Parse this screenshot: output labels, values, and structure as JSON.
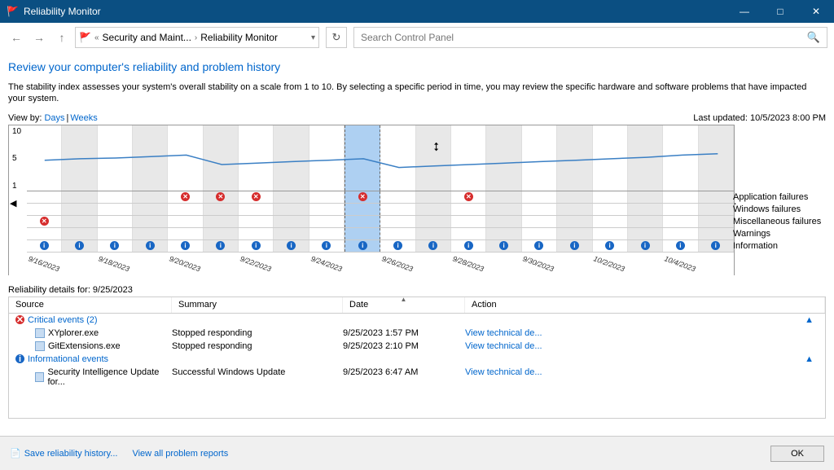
{
  "window": {
    "title": "Reliability Monitor"
  },
  "breadcrumb": {
    "segment1": "Security and Maint...",
    "segment2": "Reliability Monitor"
  },
  "search": {
    "placeholder": "Search Control Panel"
  },
  "page": {
    "title": "Review your computer's reliability and problem history",
    "description": "The stability index assesses your system's overall stability on a scale from 1 to 10. By selecting a specific period in time, you may review the specific hardware and software problems that have impacted your system.",
    "viewby_label": "View by:",
    "viewby_days": "Days",
    "viewby_weeks": "Weeks",
    "last_updated_label": "Last updated:",
    "last_updated_value": "10/5/2023 8:00 PM"
  },
  "row_labels": {
    "r1": "Application failures",
    "r2": "Windows failures",
    "r3": "Miscellaneous failures",
    "r4": "Warnings",
    "r5": "Information"
  },
  "yaxis": {
    "t10": "10",
    "t5": "5",
    "t1": "1"
  },
  "details": {
    "caption": "Reliability details for: 9/25/2023",
    "hdr_source": "Source",
    "hdr_summary": "Summary",
    "hdr_date": "Date",
    "hdr_action": "Action",
    "group_critical": "Critical events (2)",
    "group_info": "Informational events",
    "rows": {
      "r1_src": "XYplorer.exe",
      "r1_sum": "Stopped responding",
      "r1_dat": "9/25/2023 1:57 PM",
      "r1_act": "View technical de...",
      "r2_src": "GitExtensions.exe",
      "r2_sum": "Stopped responding",
      "r2_dat": "9/25/2023 2:10 PM",
      "r2_act": "View technical de...",
      "r3_src": "Security Intelligence Update for...",
      "r3_sum": "Successful Windows Update",
      "r3_dat": "9/25/2023 6:47 AM",
      "r3_act": "View technical de..."
    }
  },
  "footer": {
    "save": "Save reliability history...",
    "viewall": "View all problem reports",
    "ok": "OK"
  },
  "chart_data": {
    "type": "line",
    "title": "Stability index",
    "ylabel": "",
    "xlabel": "",
    "ylim": [
      1,
      10
    ],
    "x_dates": [
      "9/16/2023",
      "9/17/2023",
      "9/18/2023",
      "9/19/2023",
      "9/20/2023",
      "9/21/2023",
      "9/22/2023",
      "9/23/2023",
      "9/24/2023",
      "9/25/2023",
      "9/26/2023",
      "9/27/2023",
      "9/28/2023",
      "9/29/2023",
      "9/30/2023",
      "10/1/2023",
      "10/2/2023",
      "10/3/2023",
      "10/4/2023",
      "10/5/2023"
    ],
    "x_tick_labels": [
      "9/16/2023",
      "",
      "9/18/2023",
      "",
      "9/20/2023",
      "",
      "9/22/2023",
      "",
      "9/24/2023",
      "",
      "9/26/2023",
      "",
      "9/28/2023",
      "",
      "9/30/2023",
      "",
      "10/2/2023",
      "",
      "10/4/2023",
      ""
    ],
    "selected_index": 9,
    "stability_values": [
      5.2,
      5.4,
      5.5,
      5.7,
      5.9,
      4.6,
      4.8,
      5.0,
      5.2,
      5.4,
      4.2,
      4.4,
      4.6,
      4.8,
      5.0,
      5.2,
      5.4,
      5.6,
      5.9,
      6.1
    ],
    "event_rows": {
      "application_failures": [
        false,
        false,
        false,
        false,
        true,
        true,
        true,
        false,
        false,
        true,
        false,
        false,
        true,
        false,
        false,
        false,
        false,
        false,
        false,
        false
      ],
      "windows_failures": [
        false,
        false,
        false,
        false,
        false,
        false,
        false,
        false,
        false,
        false,
        false,
        false,
        false,
        false,
        false,
        false,
        false,
        false,
        false,
        false
      ],
      "miscellaneous_failures": [
        true,
        false,
        false,
        false,
        false,
        false,
        false,
        false,
        false,
        false,
        false,
        false,
        false,
        false,
        false,
        false,
        false,
        false,
        false,
        false
      ],
      "warnings": [
        false,
        false,
        false,
        false,
        false,
        false,
        false,
        false,
        false,
        false,
        false,
        false,
        false,
        false,
        false,
        false,
        false,
        false,
        false,
        false
      ],
      "information": [
        true,
        true,
        true,
        true,
        true,
        true,
        true,
        true,
        true,
        true,
        true,
        true,
        true,
        true,
        true,
        true,
        true,
        true,
        true,
        true
      ]
    }
  }
}
